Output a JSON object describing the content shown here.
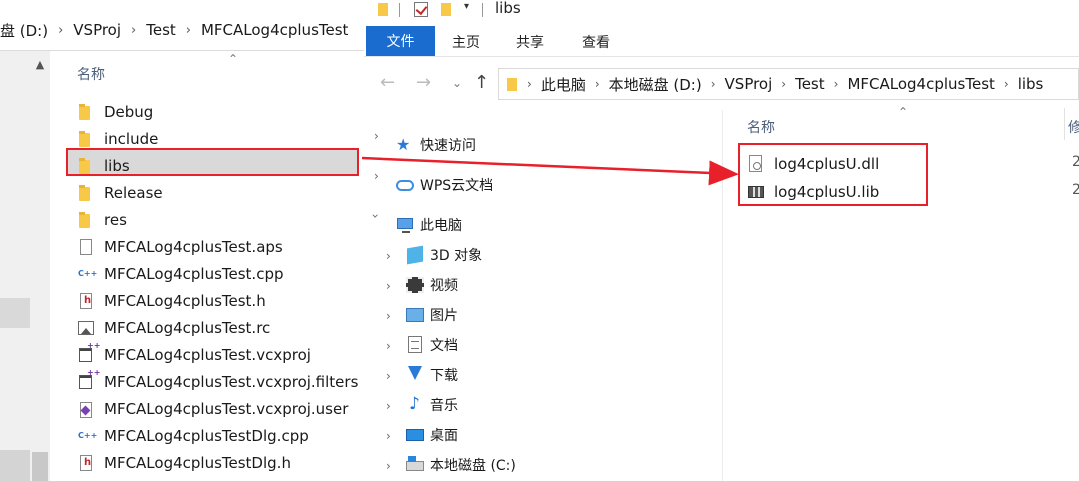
{
  "left_pane": {
    "breadcrumb": [
      "盘 (D:)",
      "VSProj",
      "Test",
      "MFCALog4cplusTest"
    ],
    "column_header": "名称",
    "items": [
      {
        "name": "Debug",
        "icon": "folder-icon"
      },
      {
        "name": "include",
        "icon": "folder-icon"
      },
      {
        "name": "libs",
        "icon": "folder-icon"
      },
      {
        "name": "Release",
        "icon": "folder-icon"
      },
      {
        "name": "res",
        "icon": "folder-icon"
      },
      {
        "name": "MFCALog4cplusTest.aps",
        "icon": "file-icon"
      },
      {
        "name": "MFCALog4cplusTest.cpp",
        "icon": "cpp-file-icon"
      },
      {
        "name": "MFCALog4cplusTest.h",
        "icon": "header-file-icon"
      },
      {
        "name": "MFCALog4cplusTest.rc",
        "icon": "resource-file-icon"
      },
      {
        "name": "MFCALog4cplusTest.vcxproj",
        "icon": "vcxproj-file-icon"
      },
      {
        "name": "MFCALog4cplusTest.vcxproj.filters",
        "icon": "filters-file-icon"
      },
      {
        "name": "MFCALog4cplusTest.vcxproj.user",
        "icon": "visual-studio-file-icon"
      },
      {
        "name": "MFCALog4cplusTestDlg.cpp",
        "icon": "cpp-file-icon"
      },
      {
        "name": "MFCALog4cplusTestDlg.h",
        "icon": "header-file-icon"
      }
    ],
    "selected_item": "libs"
  },
  "right_window": {
    "title": "libs",
    "ribbon_tabs": [
      "文件",
      "主页",
      "共享",
      "查看"
    ],
    "address": [
      "此电脑",
      "本地磁盘 (D:)",
      "VSProj",
      "Test",
      "MFCALog4cplusTest",
      "libs"
    ],
    "nav_tree": [
      {
        "label": "快速访问",
        "icon": "quick-access-star-icon",
        "level": 0,
        "expanded": false
      },
      {
        "label": "WPS云文档",
        "icon": "cloud-icon",
        "level": 0,
        "expanded": false
      },
      {
        "label": "此电脑",
        "icon": "this-pc-icon",
        "level": 0,
        "expanded": true
      },
      {
        "label": "3D 对象",
        "icon": "3d-objects-icon",
        "level": 1,
        "expanded": false
      },
      {
        "label": "视频",
        "icon": "video-icon",
        "level": 1,
        "expanded": false,
        "selected": true
      },
      {
        "label": "图片",
        "icon": "pictures-icon",
        "level": 1,
        "expanded": false
      },
      {
        "label": "文档",
        "icon": "documents-icon",
        "level": 1,
        "expanded": false
      },
      {
        "label": "下载",
        "icon": "downloads-icon",
        "level": 1,
        "expanded": false
      },
      {
        "label": "音乐",
        "icon": "music-icon",
        "level": 1,
        "expanded": false
      },
      {
        "label": "桌面",
        "icon": "desktop-icon",
        "level": 1,
        "expanded": false
      },
      {
        "label": "本地磁盘 (C:)",
        "icon": "local-disk-icon",
        "level": 1,
        "expanded": false
      }
    ],
    "column_header": "名称",
    "column_header_2": "修",
    "files": [
      {
        "name": "log4cplusU.dll",
        "icon": "dll-file-icon",
        "cut": "2"
      },
      {
        "name": "log4cplusU.lib",
        "icon": "lib-file-icon",
        "cut": "2"
      }
    ]
  },
  "colors": {
    "accent": "#1a6ccf",
    "highlight_red": "#e8202a",
    "folder": "#f8c949"
  }
}
